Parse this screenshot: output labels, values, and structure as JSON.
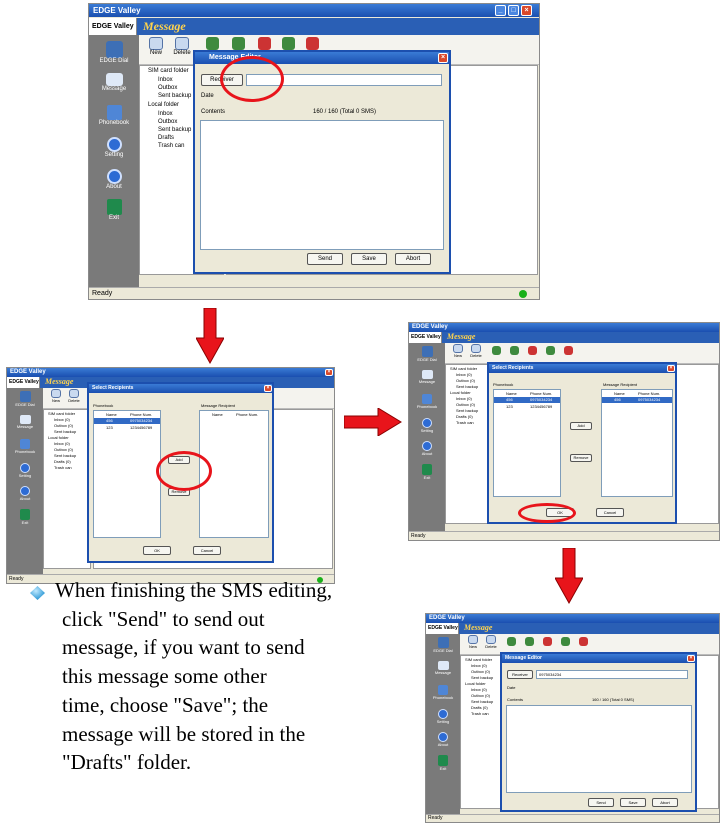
{
  "app": {
    "title": "EDGE Valley",
    "tab_label": "EDGE Valley",
    "section_title": "Message",
    "status": "Ready",
    "colors": {
      "accent": "#1a4fb0",
      "sidebar": "#7a7a7a",
      "highlight": "#e8141b",
      "section": "#ffd34d"
    }
  },
  "sidebar": {
    "items": [
      {
        "label": "EDGE Dial",
        "icon": "dial-icon"
      },
      {
        "label": "Message",
        "icon": "message-icon"
      },
      {
        "label": "Phonebook",
        "icon": "phonebook-icon"
      },
      {
        "label": "Setting",
        "icon": "setting-icon"
      },
      {
        "label": "About",
        "icon": "about-icon"
      },
      {
        "label": "Exit",
        "icon": "exit-icon"
      }
    ]
  },
  "toolbar": {
    "new_label": "New",
    "delete_label": "Delete"
  },
  "tree": {
    "items": [
      "SIM card folder",
      "Inbox",
      "Outbox",
      "Sent backup",
      "Local folder",
      "Inbox",
      "Outbox",
      "Sent backup",
      "Drafts",
      "Trash can"
    ],
    "small_items": [
      "SIM card folder",
      "Inbox (0)",
      "Outbox (0)",
      "Sent backup",
      "Local folder",
      "Inbox (0)",
      "Outbox (0)",
      "Sent backup",
      "Drafts (0)",
      "Trash can"
    ]
  },
  "editor": {
    "title": "Message Editor",
    "receiver_label": "Receiver",
    "date_label": "Date",
    "contents_label": "Contents",
    "counter": "160 / 160 (Total 0 SMS)",
    "send_label": "Send",
    "save_label": "Save",
    "abort_label": "Abort",
    "final_receiver": "0975034234"
  },
  "recipients": {
    "title": "Select Recipients",
    "phonebook_label": "Phonebook",
    "message_label": "Message Recipient",
    "col_name": "Name",
    "col_phone": "Phone Num.",
    "rows": [
      {
        "name": "456",
        "phone": "0975034234"
      },
      {
        "name": "123",
        "phone": "1234456789"
      }
    ],
    "add_label": "Add",
    "remove_label": "Remove",
    "ok_label": "OK",
    "cancel_label": "Cancel"
  },
  "caption": {
    "lines": [
      "When finishing the SMS editing,",
      "click \"Send\" to send out",
      "message, if you want to send",
      "this message some other",
      "time, choose \"Save\"; the",
      "message will be stored in the",
      "\"Drafts\" folder."
    ]
  }
}
